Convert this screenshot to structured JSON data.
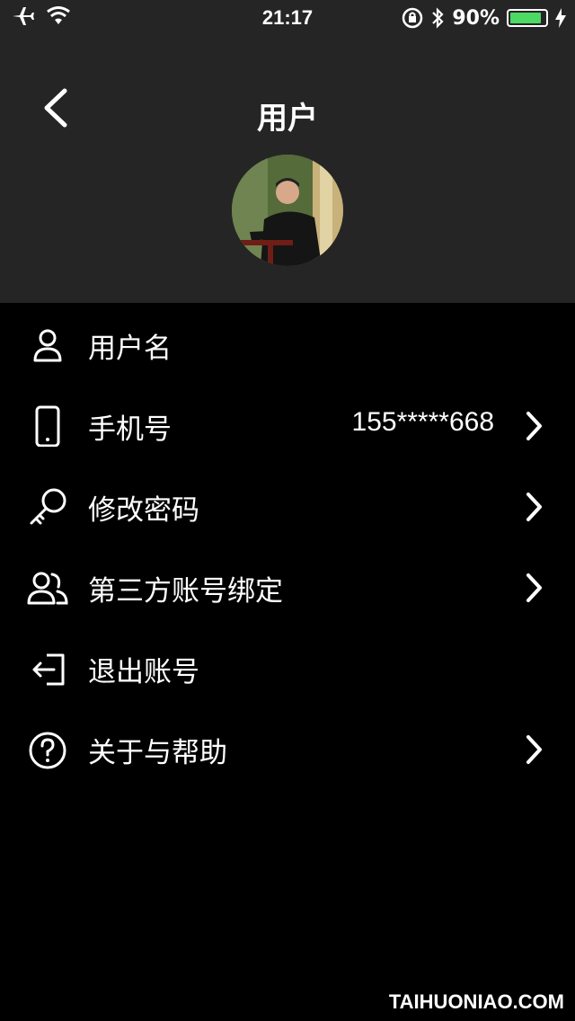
{
  "status_bar": {
    "time": "21:17",
    "battery_percent": "90%",
    "battery_level": 0.9,
    "battery_color": "#4cd964"
  },
  "header": {
    "title": "用户",
    "back_icon": "chevron-left-icon",
    "avatar_icon": "user-photo"
  },
  "menu": {
    "items": [
      {
        "label": "用户名",
        "icon": "user-icon",
        "value": "",
        "has_chevron": false
      },
      {
        "label": "手机号",
        "icon": "phone-icon",
        "value": "155*****668",
        "has_chevron": true
      },
      {
        "label": "修改密码",
        "icon": "key-icon",
        "value": "",
        "has_chevron": true
      },
      {
        "label": "第三方账号绑定",
        "icon": "users-icon",
        "value": "",
        "has_chevron": true
      },
      {
        "label": "退出账号",
        "icon": "logout-icon",
        "value": "",
        "has_chevron": false
      },
      {
        "label": "关于与帮助",
        "icon": "help-icon",
        "value": "",
        "has_chevron": true
      }
    ]
  },
  "watermark": "TAIHUONIAO.COM",
  "colors": {
    "header_bg": "#252525",
    "page_bg": "#000000",
    "text": "#ffffff"
  }
}
